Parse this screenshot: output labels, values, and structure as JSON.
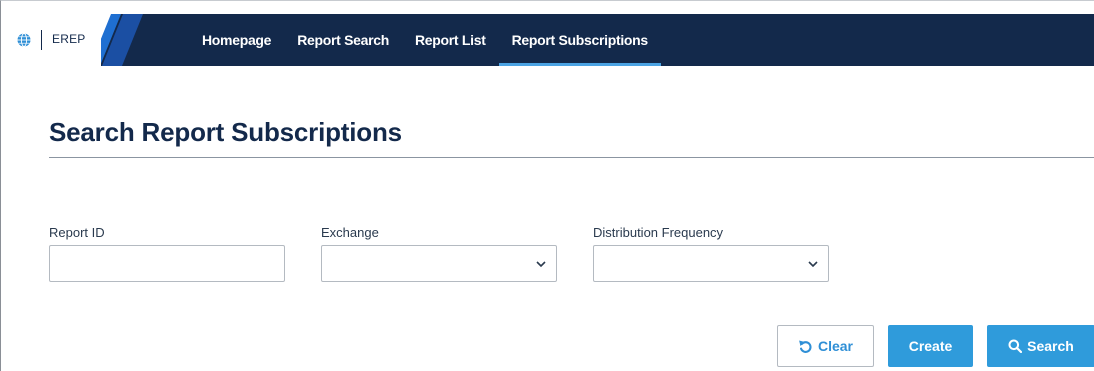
{
  "brand": {
    "name": "EREP",
    "icon": "globe-icon"
  },
  "nav": {
    "items": [
      {
        "label": "Homepage",
        "active": false
      },
      {
        "label": "Report Search",
        "active": false
      },
      {
        "label": "Report List",
        "active": false
      },
      {
        "label": "Report Subscriptions",
        "active": true
      }
    ]
  },
  "page": {
    "title": "Search Report Subscriptions"
  },
  "form": {
    "report_id": {
      "label": "Report ID",
      "value": ""
    },
    "exchange": {
      "label": "Exchange",
      "selected": ""
    },
    "distribution_frequency": {
      "label": "Distribution Frequency",
      "selected": ""
    }
  },
  "actions": {
    "clear_label": "Clear",
    "create_label": "Create",
    "search_label": "Search"
  },
  "colors": {
    "nav_bg": "#13294b",
    "accent": "#2f9bdb",
    "active_underline": "#4ba3e3"
  }
}
